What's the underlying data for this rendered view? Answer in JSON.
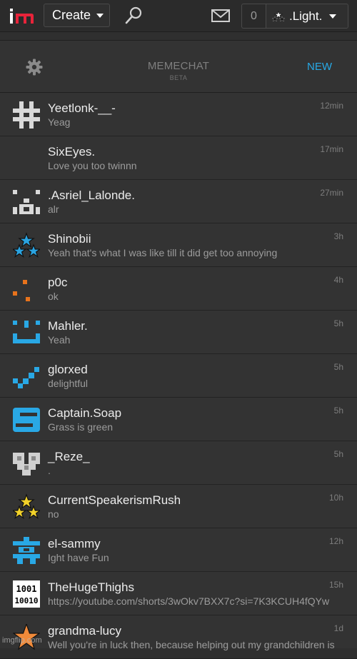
{
  "nav": {
    "create_label": "Create",
    "notif_count": "0",
    "username": ".Light."
  },
  "chat": {
    "title": "MEMECHAT",
    "subtitle": "BETA",
    "new_label": "NEW",
    "accent": "#27a9e6"
  },
  "conversations": [
    {
      "name": "Yeetlonk-__-",
      "message": "Yeag",
      "time": "12min",
      "avatar": "hash-glyph-gray"
    },
    {
      "name": "SixEyes.",
      "message": "Love you too twinnn",
      "time": "17min",
      "avatar": "blank"
    },
    {
      "name": ".Asriel_Lalonde.",
      "message": "alr",
      "time": "27min",
      "avatar": "face-glyph-gray"
    },
    {
      "name": "Shinobii",
      "message": "Yeah that's what I was like till it did get too annoying",
      "time": "3h",
      "avatar": "three-blue-stars"
    },
    {
      "name": "p0c",
      "message": "ok",
      "time": "4h",
      "avatar": "orange-dots"
    },
    {
      "name": "Mahler.",
      "message": "Yeah",
      "time": "5h",
      "avatar": "blue-smile"
    },
    {
      "name": "glorxed",
      "message": "delightful",
      "time": "5h",
      "avatar": "blue-check"
    },
    {
      "name": "Captain.Soap",
      "message": "Grass is green",
      "time": "5h",
      "avatar": "blue-s"
    },
    {
      "name": "_Reze_",
      "message": ".",
      "time": "5h",
      "avatar": "gray-heart"
    },
    {
      "name": "CurrentSpeakerismRush",
      "message": "no",
      "time": "10h",
      "avatar": "three-yellow-stars"
    },
    {
      "name": "el-sammy",
      "message": "Ight have Fun",
      "time": "12h",
      "avatar": "blue-totem"
    },
    {
      "name": "TheHugeThighs",
      "message": "https://youtube.com/shorts/3wOkv7BXX7c?si=7K3KCUH4fQYw",
      "time": "15h",
      "avatar": "binary-digits"
    },
    {
      "name": "grandma-lucy",
      "message": "Well you're in luck then, because helping out my grandchildren is",
      "time": "1d",
      "avatar": "orange-star"
    }
  ],
  "watermark": "imgflip.com",
  "avatar_text": {
    "binary_top": "1001",
    "binary_bottom": "10010"
  }
}
